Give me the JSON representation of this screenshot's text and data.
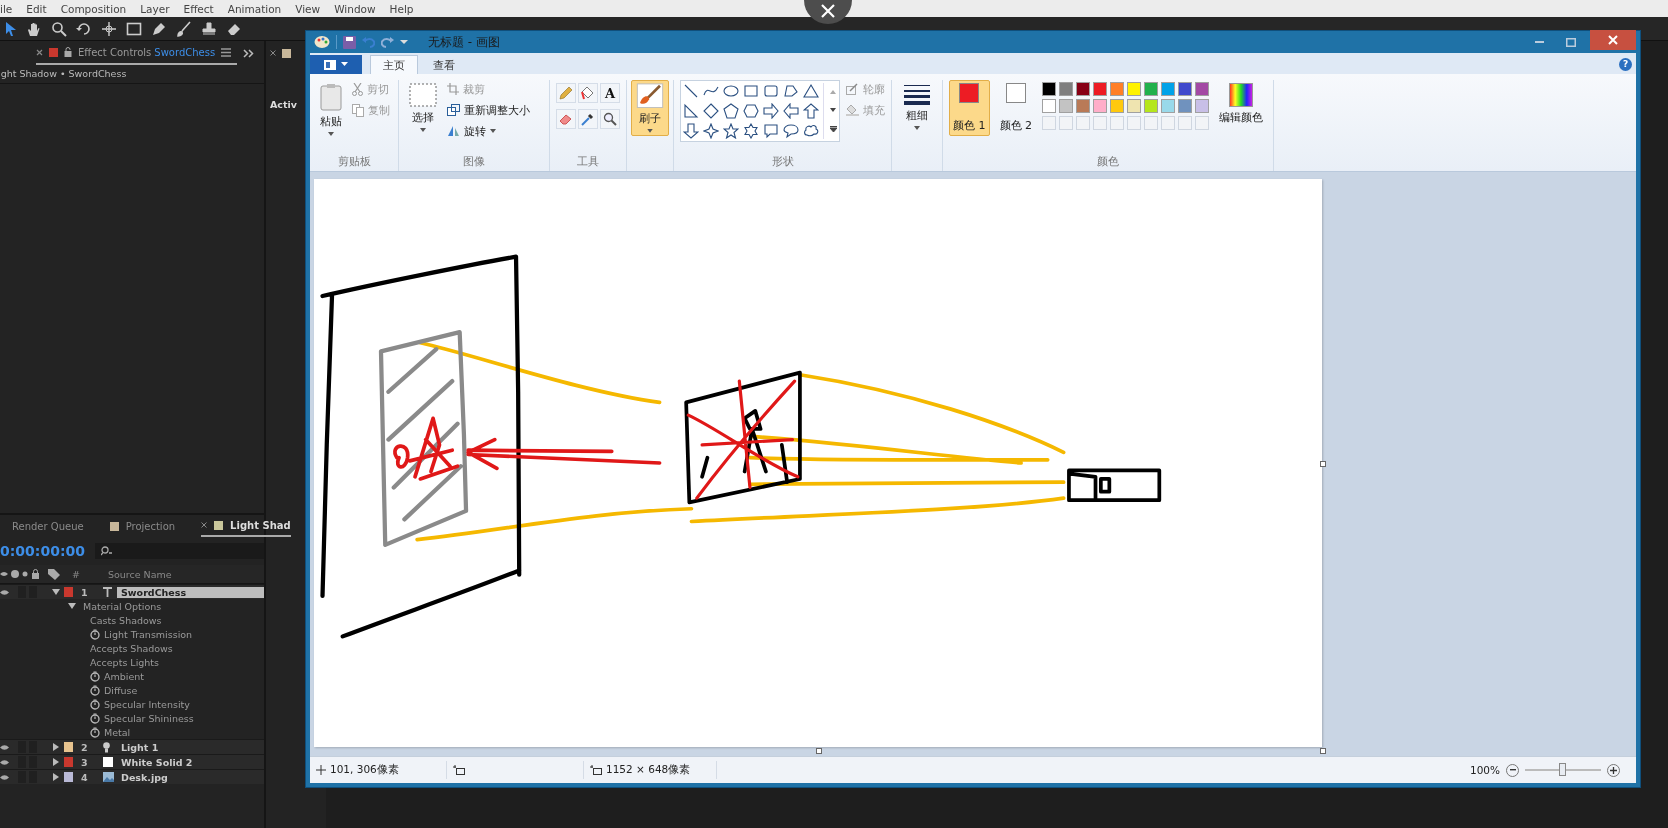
{
  "ae_menu": [
    "ile",
    "Edit",
    "Composition",
    "Layer",
    "Effect",
    "Animation",
    "View",
    "Window",
    "Help"
  ],
  "effect_controls": {
    "tab_label": "Effect Controls",
    "tab_layer": "SwordChess",
    "breadcrumb": "ight Shadow • SwordChess"
  },
  "viewer": {
    "label": "Activ"
  },
  "timeline": {
    "tabs": [
      {
        "label": "Render Queue",
        "selected": false
      },
      {
        "label": "Projection",
        "selected": false,
        "color": "#c8b79a"
      },
      {
        "label": "Light Shad",
        "selected": true,
        "color": "#c9c69a"
      }
    ],
    "timecode": "0:00:00:00",
    "column_number": "#",
    "column_source": "Source Name",
    "layers": [
      {
        "number": "1",
        "name": "SwordChess",
        "kind": "text",
        "color": "#c9382e",
        "selected": true,
        "expanded": true,
        "group": {
          "label": "Material Options",
          "expanded": true,
          "properties": [
            {
              "label": "Casts Shadows",
              "stopwatch": false
            },
            {
              "label": "Light Transmission",
              "stopwatch": true
            },
            {
              "label": "Accepts Shadows",
              "stopwatch": false
            },
            {
              "label": "Accepts Lights",
              "stopwatch": false
            },
            {
              "label": "Ambient",
              "stopwatch": true
            },
            {
              "label": "Diffuse",
              "stopwatch": true
            },
            {
              "label": "Specular Intensity",
              "stopwatch": true
            },
            {
              "label": "Specular Shininess",
              "stopwatch": true
            },
            {
              "label": "Metal",
              "stopwatch": true
            }
          ]
        }
      },
      {
        "number": "2",
        "name": "Light 1",
        "kind": "light",
        "color": "#e8c48f",
        "selected": false,
        "expanded": false
      },
      {
        "number": "3",
        "name": "White Solid 2",
        "kind": "solid",
        "color": "#c9382e",
        "selected": false,
        "expanded": false
      },
      {
        "number": "4",
        "name": "Desk.jpg",
        "kind": "image",
        "color": "#b9b9d6",
        "selected": false,
        "expanded": false
      }
    ]
  },
  "paint": {
    "title": "无标题 - 画图",
    "help": "?",
    "tabs": [
      {
        "label": "主页",
        "selected": true
      },
      {
        "label": "查看",
        "selected": false
      }
    ],
    "clipboard": {
      "paste": {
        "label": "粘贴",
        "disabled": false
      },
      "cut": {
        "label": "剪切",
        "disabled": true
      },
      "copy": {
        "label": "复制",
        "disabled": true
      },
      "label": "剪贴板"
    },
    "image": {
      "select": "选择",
      "crop": {
        "label": "裁剪",
        "disabled": true
      },
      "resize": {
        "label": "重新调整大小",
        "disabled": false
      },
      "rotate": {
        "label": "旋转",
        "disabled": false
      },
      "label": "图像"
    },
    "tools": {
      "text_tool": "A",
      "label": "工具"
    },
    "brush": {
      "label": "刷子",
      "selected": true
    },
    "shapes": {
      "outline": "轮廓",
      "fill": "填充",
      "label": "形状"
    },
    "size": {
      "label": "粗细"
    },
    "colors": {
      "slots": [
        {
          "label": "颜色 1",
          "color": "#ed1c24",
          "selected": true
        },
        {
          "label": "颜色 2",
          "color": "#ffffff",
          "selected": false
        }
      ],
      "palette": [
        {
          "color": "#000000"
        },
        {
          "color": "#7f7f7f"
        },
        {
          "color": "#880015"
        },
        {
          "color": "#ed1c24"
        },
        {
          "color": "#ff7f27"
        },
        {
          "color": "#fff200"
        },
        {
          "color": "#22b14c"
        },
        {
          "color": "#00a2e8"
        },
        {
          "color": "#3f48cc"
        },
        {
          "color": "#a349a4"
        },
        {
          "color": "#ffffff"
        },
        {
          "color": "#c3c3c3"
        },
        {
          "color": "#b97a57"
        },
        {
          "color": "#ffaec9"
        },
        {
          "color": "#ffc90e"
        },
        {
          "color": "#efe4b0"
        },
        {
          "color": "#b5e61d"
        },
        {
          "color": "#99d9ea"
        },
        {
          "color": "#7092be"
        },
        {
          "color": "#c8bfe7"
        }
      ],
      "edit": "编辑颜色",
      "label": "颜色"
    },
    "status": {
      "position": "101, 306像素",
      "size": "1152 × 648像素",
      "zoom": "100%",
      "zoom_slider": {
        "level": 0.5
      }
    }
  }
}
